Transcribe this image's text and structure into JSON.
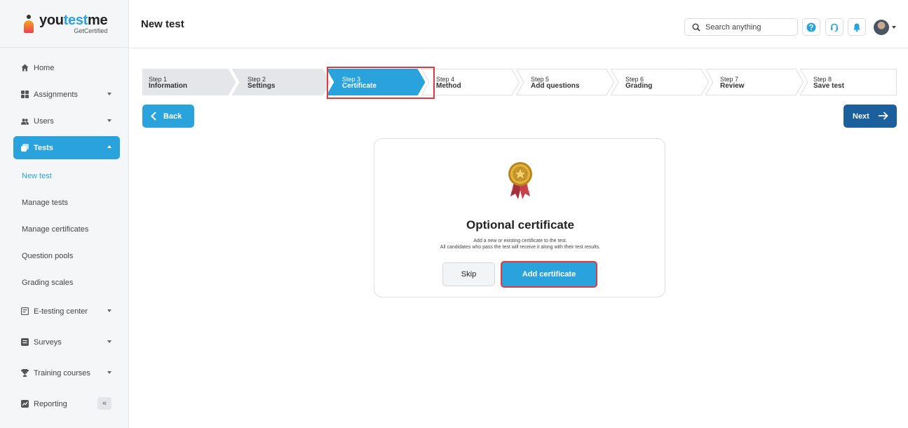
{
  "brand": {
    "name_part1": "you",
    "name_part2": "test",
    "name_part3": "me",
    "tagline": "GetCertified"
  },
  "header": {
    "title": "New test",
    "search_placeholder": "Search anything"
  },
  "sidebar": {
    "items": [
      {
        "label": "Home",
        "icon": "home-icon"
      },
      {
        "label": "Assignments",
        "icon": "assignments-icon"
      },
      {
        "label": "Users",
        "icon": "users-icon"
      },
      {
        "label": "Tests",
        "icon": "tests-icon",
        "active": true
      }
    ],
    "sub_items": [
      "New test",
      "Manage tests",
      "Manage certificates",
      "Question pools",
      "Grading scales"
    ],
    "items_bottom": [
      {
        "label": "E-testing center",
        "icon": "etesting-icon"
      },
      {
        "label": "Surveys",
        "icon": "surveys-icon"
      },
      {
        "label": "Training courses",
        "icon": "trophy-icon"
      },
      {
        "label": "Reporting",
        "icon": "reporting-icon"
      }
    ],
    "collapse_label": "«"
  },
  "stepper": {
    "steps": [
      {
        "num": "Step 1",
        "name": "Information",
        "state": "done"
      },
      {
        "num": "Step 2",
        "name": "Settings",
        "state": "done"
      },
      {
        "num": "Step 3",
        "name": "Certificate",
        "state": "current"
      },
      {
        "num": "Step 4",
        "name": "Method",
        "state": "todo"
      },
      {
        "num": "Step 5",
        "name": "Add questions",
        "state": "todo"
      },
      {
        "num": "Step 6",
        "name": "Grading",
        "state": "todo"
      },
      {
        "num": "Step 7",
        "name": "Review",
        "state": "todo"
      },
      {
        "num": "Step 8",
        "name": "Save test",
        "state": "todo"
      }
    ]
  },
  "nav_buttons": {
    "back": "Back",
    "next": "Next"
  },
  "card": {
    "title": "Optional certificate",
    "desc_line1": "Add a new or existing certificate to the test.",
    "desc_line2": "All candidates who pass the test will receive it along with their test results.",
    "skip": "Skip",
    "add": "Add certificate"
  },
  "colors": {
    "accent": "#2aa3dc",
    "next": "#1b5f9c",
    "highlight": "#e0393e",
    "step_done": "#e4e6ea"
  }
}
